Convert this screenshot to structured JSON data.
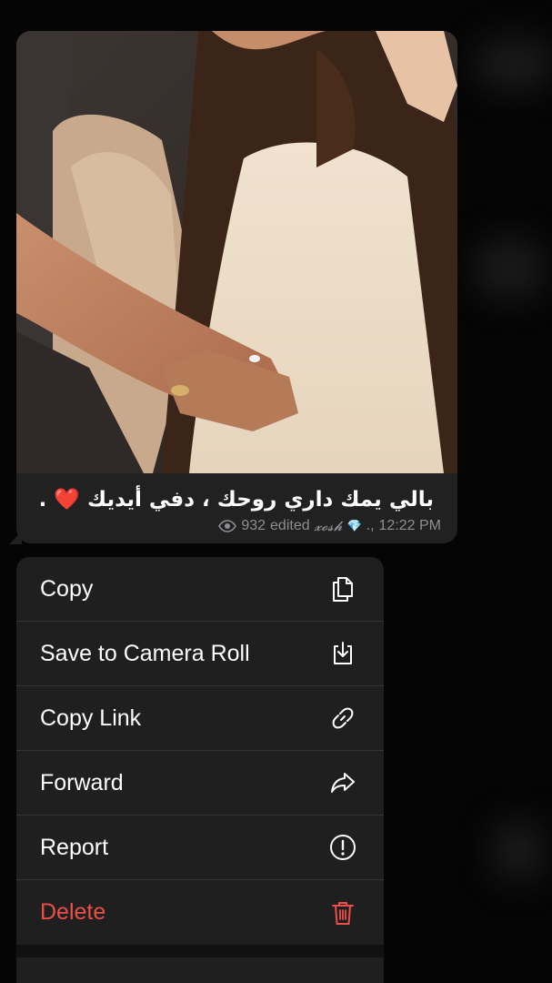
{
  "message": {
    "caption_text": "بالي يمك داري روحك ، دفي أيديك",
    "caption_heart": "❤️",
    "caption_dot": ".",
    "views": "932",
    "edited_label": "edited",
    "author": "𝔁𝓸𝓼𝓱",
    "author_emoji": "💎",
    "author_suffix": ".,",
    "time": "12:22 PM"
  },
  "menu": {
    "items": [
      {
        "label": "Copy",
        "icon": "copy-icon"
      },
      {
        "label": "Save to Camera Roll",
        "icon": "save-download-icon"
      },
      {
        "label": "Copy Link",
        "icon": "link-icon"
      },
      {
        "label": "Forward",
        "icon": "forward-arrow-icon"
      },
      {
        "label": "Report",
        "icon": "exclamation-circle-icon"
      },
      {
        "label": "Delete",
        "icon": "trash-icon"
      }
    ]
  },
  "colors": {
    "delete": "#ec4f48",
    "menu_bg": "#1f1f1f",
    "bubble_bg": "#212121",
    "meta_text": "#8e8e93"
  }
}
